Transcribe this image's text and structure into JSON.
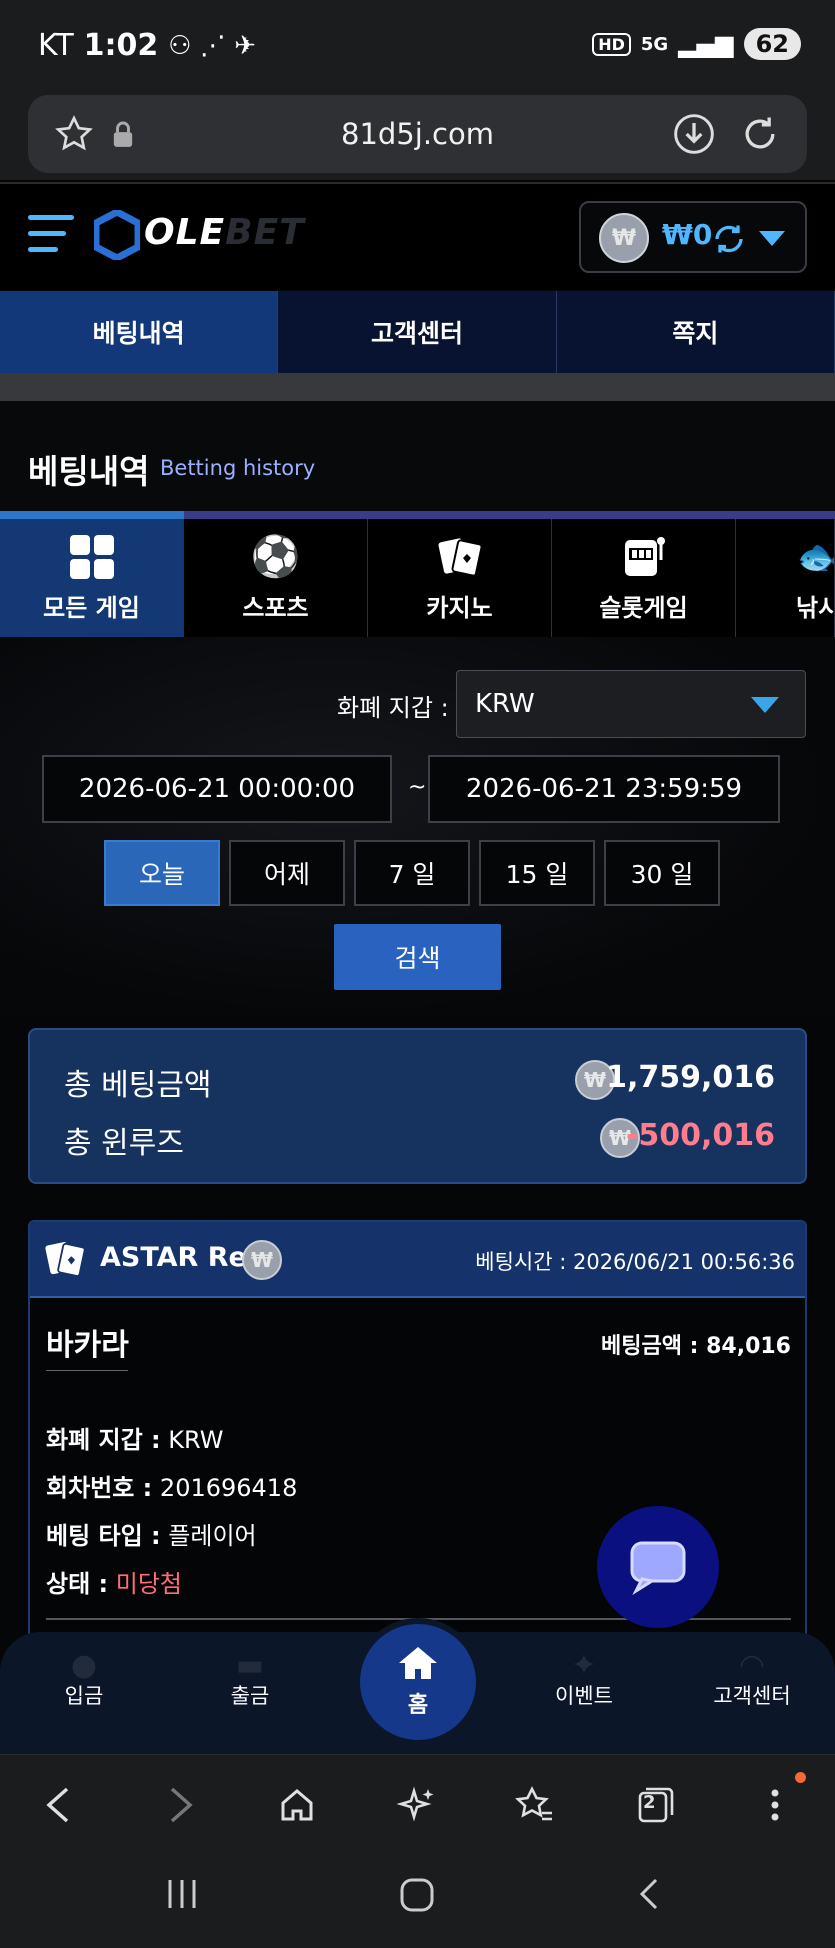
{
  "status_bar": {
    "carrier": "KT",
    "time": "1:02",
    "hd": "HD",
    "network": "5G",
    "battery": "62"
  },
  "browser": {
    "url": "81d5j.com",
    "tabs_count": "2"
  },
  "site": {
    "logo_ole": "OLE",
    "logo_bet": "BET",
    "wallet_amount": "₩0"
  },
  "top_tabs": [
    {
      "label": "베팅내역",
      "active": true
    },
    {
      "label": "고객센터",
      "active": false
    },
    {
      "label": "쪽지",
      "active": false
    }
  ],
  "heading": {
    "title_ko": "베팅내역",
    "title_en": "Betting history"
  },
  "categories": [
    {
      "label": "모든 게임",
      "icon": "grid-icon",
      "active": true
    },
    {
      "label": "스포츠",
      "icon": "soccer-ball-icon",
      "active": false
    },
    {
      "label": "카지노",
      "icon": "playing-cards-icon",
      "active": false
    },
    {
      "label": "슬롯게임",
      "icon": "slot-machine-icon",
      "active": false
    },
    {
      "label": "낚시",
      "icon": "fishing-icon",
      "active": false
    }
  ],
  "filter": {
    "wallet_label": "화폐 지갑 :",
    "currency": "KRW",
    "date_start": "2026-06-21 00:00:00",
    "date_separator": "~",
    "date_end": "2026-06-21 23:59:59",
    "quick_ranges": [
      "오늘",
      "어제",
      "7 일",
      "15 일",
      "30 일"
    ],
    "search_label": "검색"
  },
  "summary": {
    "total_bet_label": "총 베팅금액",
    "total_bet_value": "1,759,016",
    "total_winloss_label": "총 윈루즈",
    "total_winloss_value": "-500,016",
    "coin_symbol": "₩"
  },
  "bet_card": {
    "provider": "ASTAR Real",
    "bet_time_label": "베팅시간 :",
    "bet_time": "2026/06/21 00:56:36",
    "game_name": "바카라",
    "bet_amount_label": "베팅금액 :",
    "bet_amount": "84,016",
    "details": [
      {
        "label": "화폐 지갑 :",
        "value": "KRW"
      },
      {
        "label": "회차번호 :",
        "value": "201696418"
      },
      {
        "label": "베팅 타입 :",
        "value": "플레이어"
      },
      {
        "label": "상태 :",
        "value": "미당첨"
      }
    ]
  },
  "bottom_nav": {
    "deposit": "입금",
    "withdraw": "출금",
    "home": "홈",
    "event": "이벤트",
    "support": "고객센터"
  },
  "colors": {
    "accent_blue": "#2a62c0",
    "loss_red": "#ff6b7a",
    "wallet_cyan": "#4fb6ff"
  }
}
